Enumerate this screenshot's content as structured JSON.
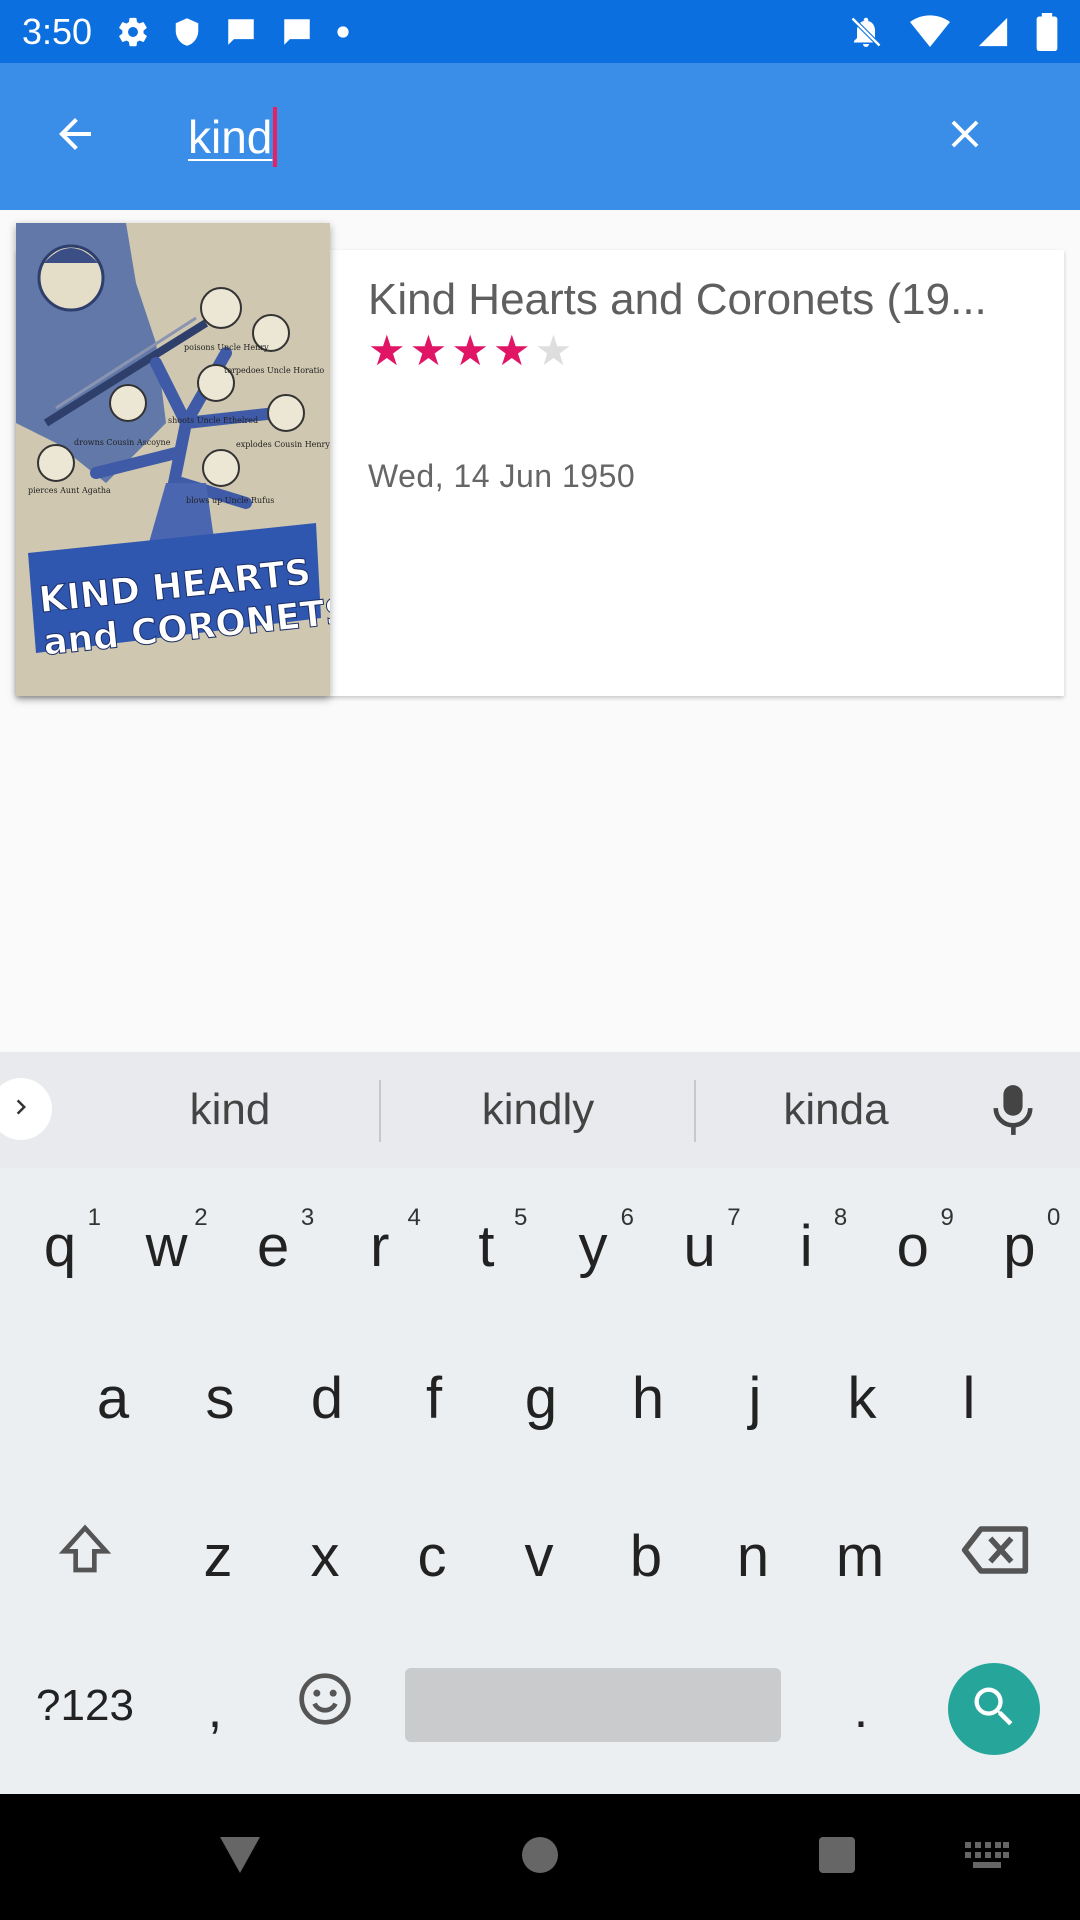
{
  "status_bar": {
    "time": "3:50",
    "left_icons": [
      "gear-icon",
      "shield-icon",
      "message-icon",
      "message-icon",
      "dot-icon"
    ],
    "right_icons": [
      "notifications-off-icon",
      "wifi-icon",
      "signal-icon",
      "battery-icon"
    ]
  },
  "search": {
    "query": "kind",
    "back_icon": "arrow-back-icon",
    "clear_icon": "close-icon"
  },
  "results": [
    {
      "title": "Kind Hearts and Coronets (19...",
      "rating_of_5": 4,
      "date": "Wed, 14 Jun 1950",
      "poster": {
        "title_line1": "KIND HEARTS",
        "title_line2": "and CORONETS",
        "captions": [
          "poisons Uncle Henry",
          "torpedoes Uncle Horatio",
          "shoots Uncle Ethelred",
          "explodes Cousin Henry",
          "drowns Cousin Ascoyne",
          "pierces Aunt Agatha",
          "blows up Uncle Rufus"
        ]
      }
    }
  ],
  "keyboard": {
    "suggestions": [
      "kind",
      "kindly",
      "kinda"
    ],
    "row1": [
      {
        "key": "q",
        "hint": "1"
      },
      {
        "key": "w",
        "hint": "2"
      },
      {
        "key": "e",
        "hint": "3"
      },
      {
        "key": "r",
        "hint": "4"
      },
      {
        "key": "t",
        "hint": "5"
      },
      {
        "key": "y",
        "hint": "6"
      },
      {
        "key": "u",
        "hint": "7"
      },
      {
        "key": "i",
        "hint": "8"
      },
      {
        "key": "o",
        "hint": "9"
      },
      {
        "key": "p",
        "hint": "0"
      }
    ],
    "row2": [
      "a",
      "s",
      "d",
      "f",
      "g",
      "h",
      "j",
      "k",
      "l"
    ],
    "row3": [
      "z",
      "x",
      "c",
      "v",
      "b",
      "n",
      "m"
    ],
    "symbols_label": "?123",
    "comma": ",",
    "period": ".",
    "colors": {
      "search_key": "#26a69a",
      "accent": "#e01565",
      "app_bar": "#3a8ee8",
      "status_bar": "#0b6fdf"
    }
  },
  "nav_bar": {
    "icons": [
      "back-triangle-icon",
      "home-circle-icon",
      "recents-square-icon",
      "keyboard-icon"
    ]
  }
}
